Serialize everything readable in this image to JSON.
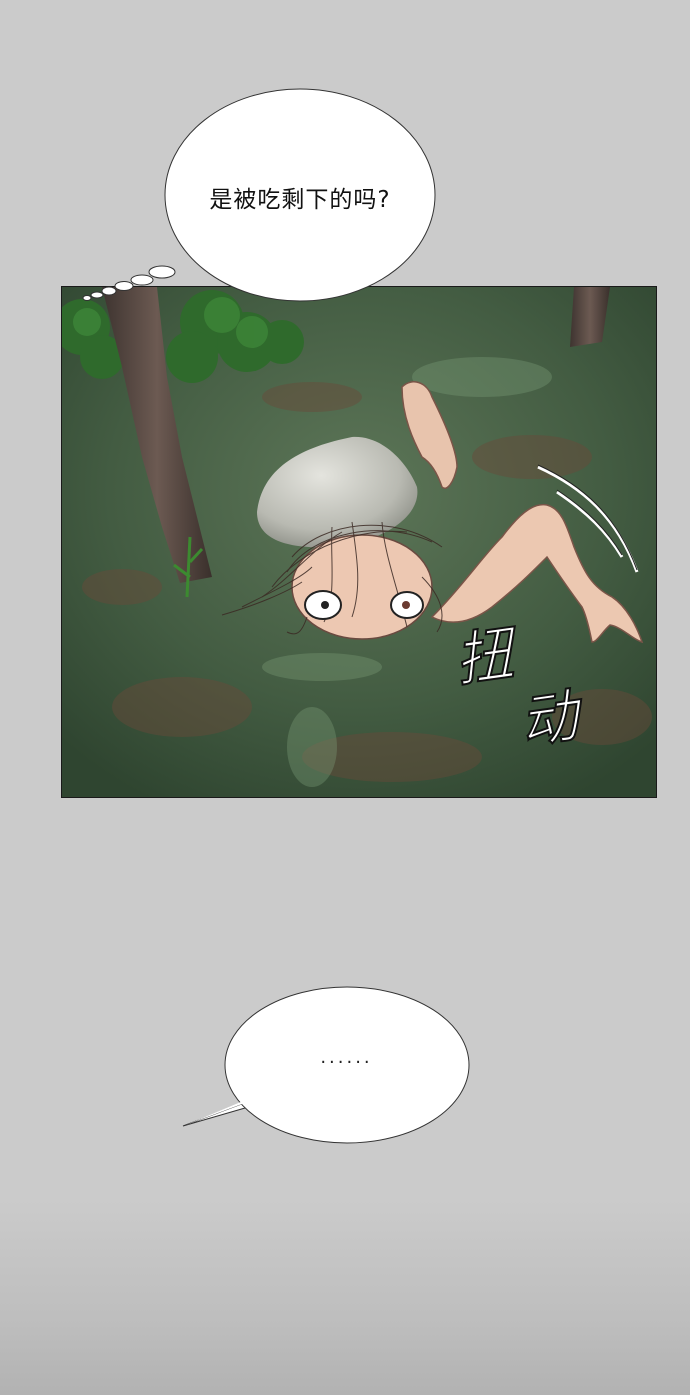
{
  "thought_bubble": {
    "text": "是被吃剩下的吗?"
  },
  "speech_bubble": {
    "text": "......"
  },
  "sound_effect": {
    "chars": [
      "扭",
      "动"
    ]
  }
}
